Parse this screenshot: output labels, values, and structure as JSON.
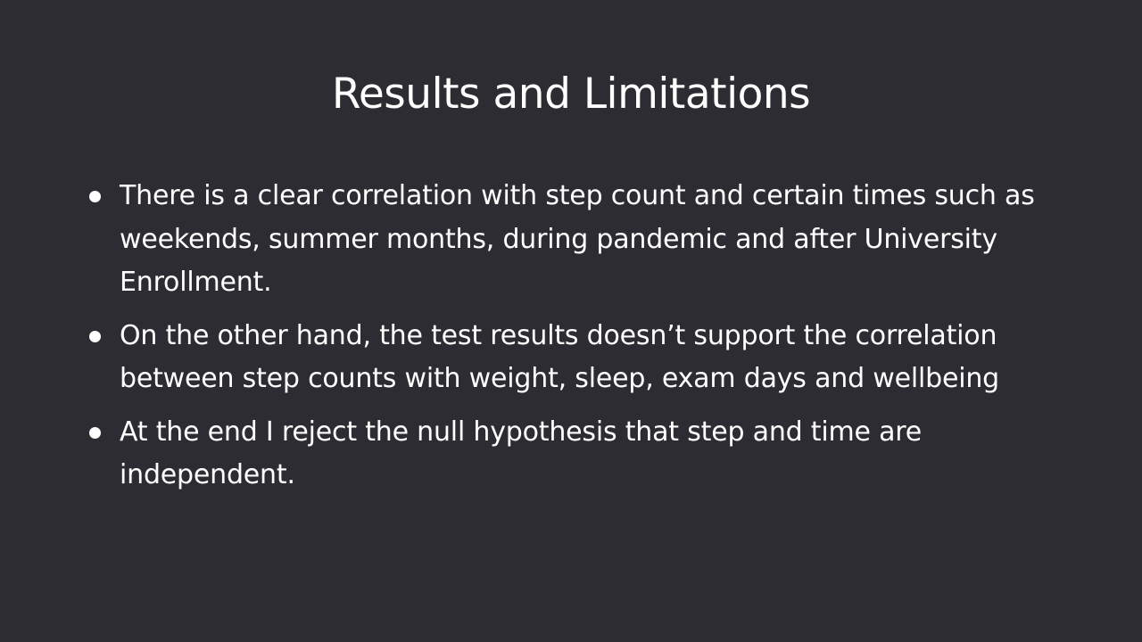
{
  "slide": {
    "title": "Results and Limitations",
    "bullets": [
      {
        "text": "There is a clear correlation with step count and certain times such as weekends, summer months, during pandemic and after University Enrollment."
      },
      {
        "text": "On the other hand, the test results doesn’t support the correlation between step counts with weight, sleep, exam days and wellbeing"
      },
      {
        "text": "At the end I reject the null hypothesis that step and time are independent."
      }
    ]
  },
  "colors": {
    "background": "#2d2c32",
    "text": "#ffffff"
  }
}
